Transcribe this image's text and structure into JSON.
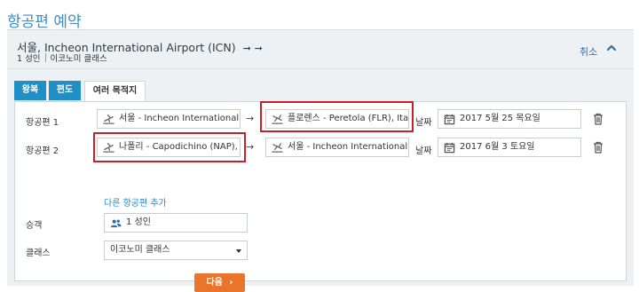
{
  "page": {
    "title": "항공편 예약"
  },
  "summary": {
    "route": "서울, Incheon International Airport (ICN)",
    "route_arrows": "➞ ➞",
    "passengers": "1 성인",
    "cabin": "이코노미 클래스",
    "cancel_label": "취소",
    "collapse_icon": "chevron-up-icon"
  },
  "tabs": [
    {
      "label": "왕복",
      "active": false
    },
    {
      "label": "편도",
      "active": false
    },
    {
      "label": "여러 목적지",
      "active": true
    }
  ],
  "flights": [
    {
      "label": "항공편 1",
      "origin": "서울 - Incheon International Airport (ICN)",
      "destination": "플로렌스 - Peretola (FLR), Italy",
      "date_label": "날짜",
      "date": "2017 5월 25 목요일"
    },
    {
      "label": "항공편 2",
      "origin": "나폴리 - Capodichino (NAP), Italy",
      "destination": "서울 - Incheon International Airport (ICN)",
      "date_label": "날짜",
      "date": "2017 6월 3 토요일"
    }
  ],
  "add_flight_label": "다른 항공편 추가",
  "passengers_section": {
    "label": "승객",
    "value": "1 성인"
  },
  "class_section": {
    "label": "클래스",
    "value": "이코노미 클래스"
  },
  "next_button": {
    "label": "다음",
    "chevron": "›"
  },
  "colors": {
    "accent": "#1f8fc6",
    "title": "#3e8ec7",
    "next_button": "#e9752a",
    "highlight": "#c8202a"
  }
}
